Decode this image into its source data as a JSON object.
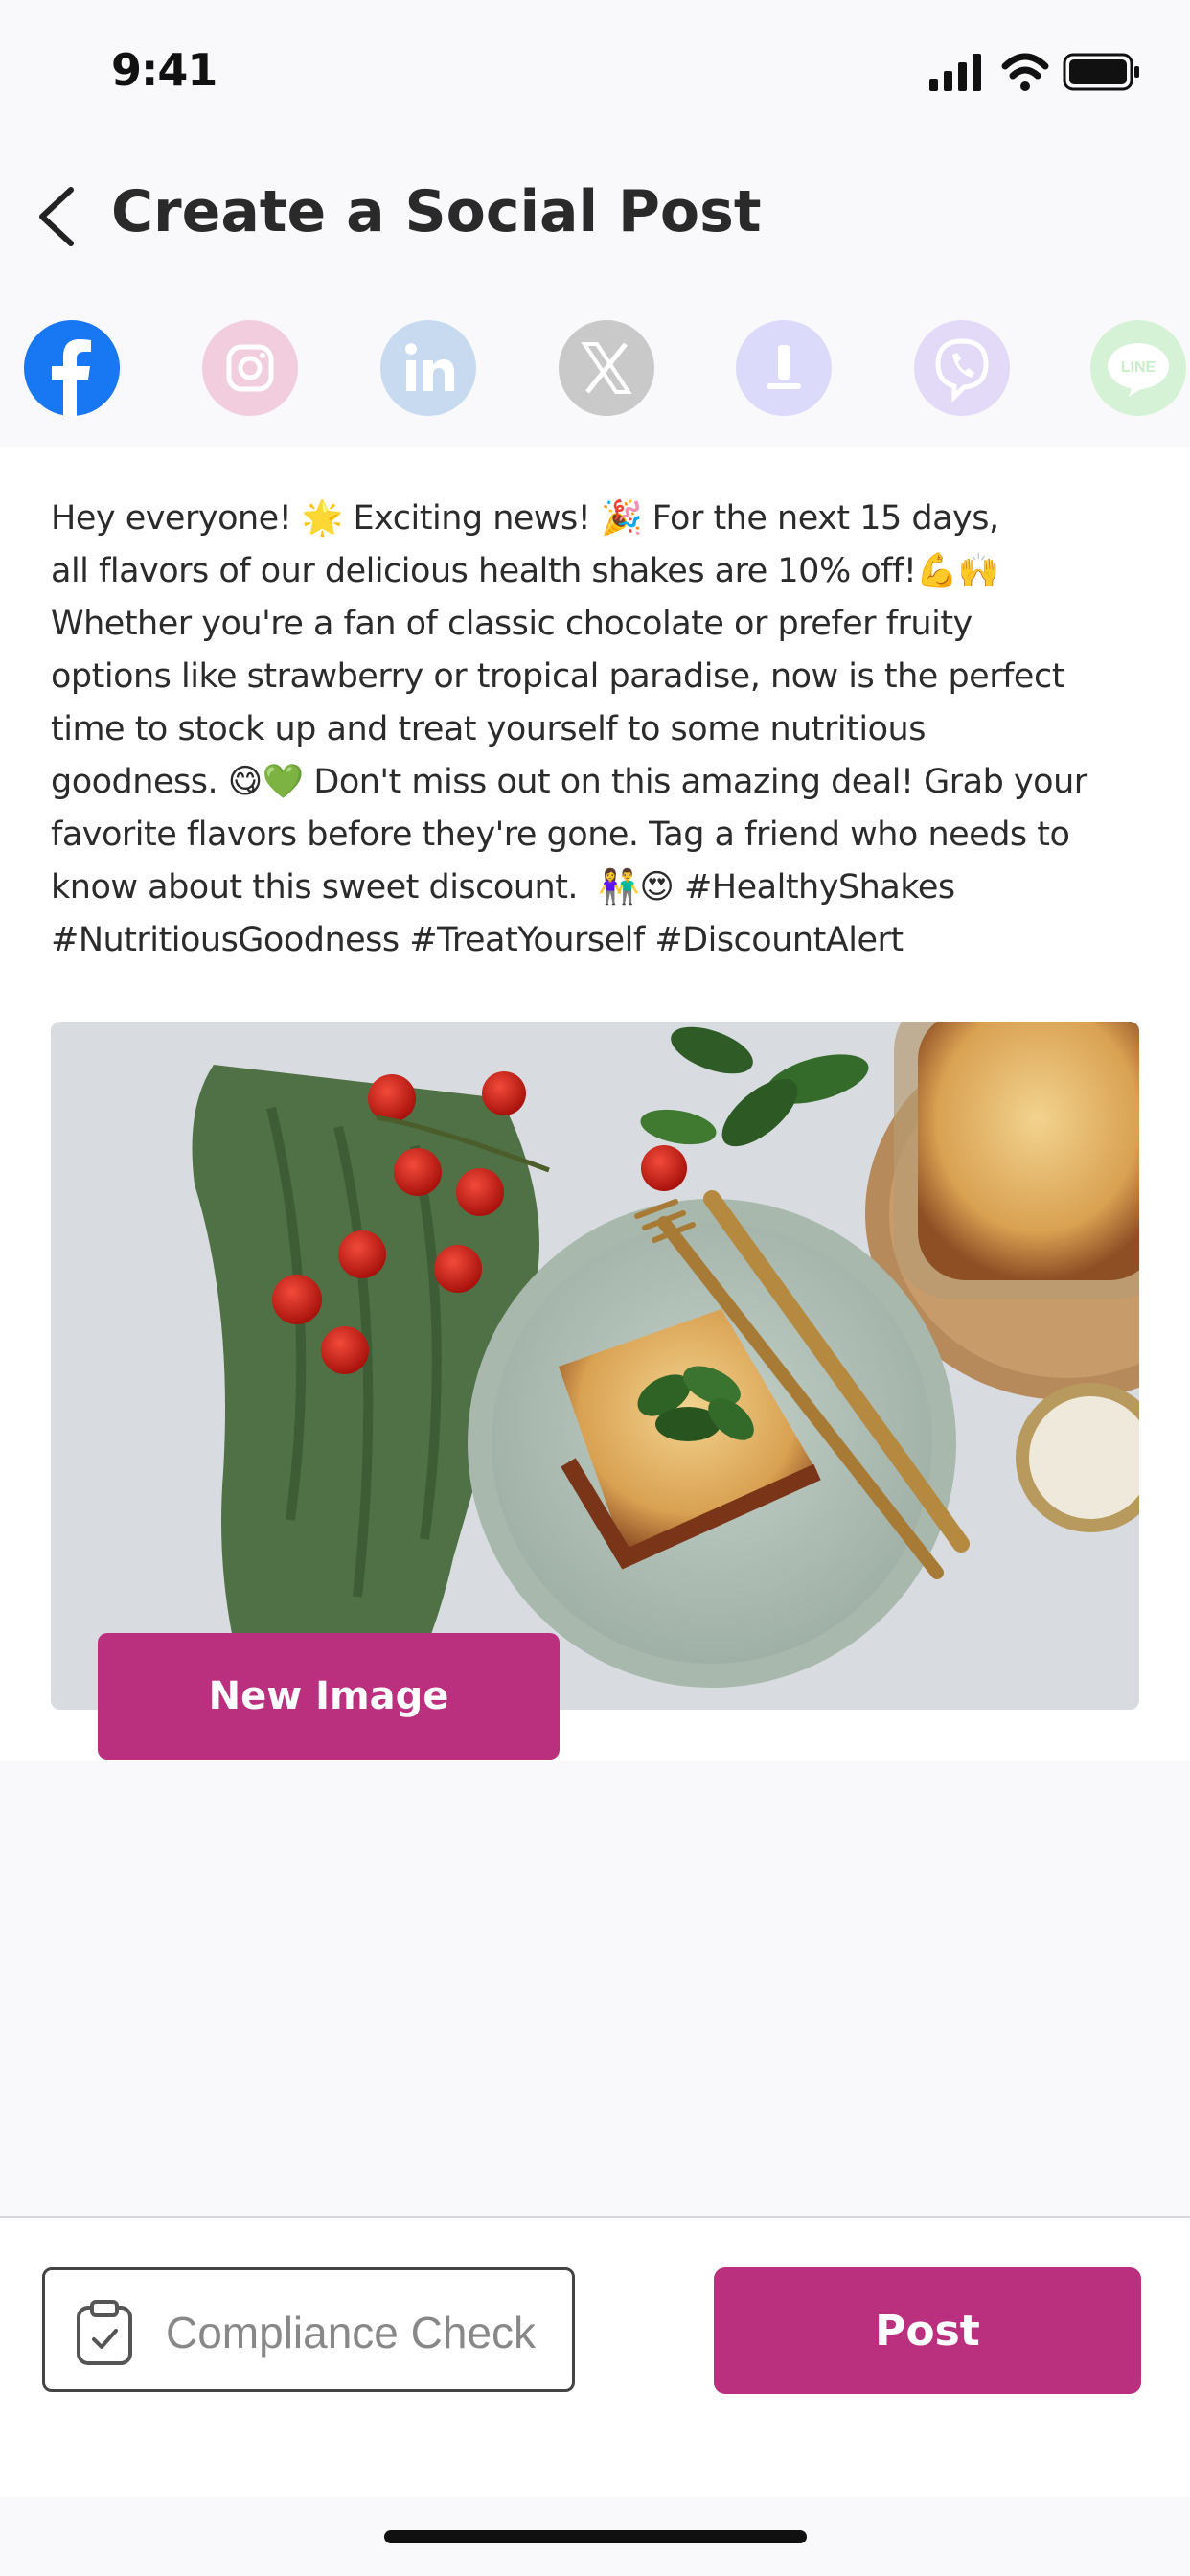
{
  "status_bar": {
    "time": "9:41",
    "icons": [
      "signal-icon",
      "wifi-icon",
      "battery-icon"
    ]
  },
  "header": {
    "back_icon": "chevron-left-icon",
    "title": "Create a Social Post"
  },
  "platforms": [
    {
      "name": "Facebook",
      "icon": "facebook-icon",
      "selected": true,
      "color": "#1877F2"
    },
    {
      "name": "Instagram",
      "icon": "instagram-icon",
      "selected": false,
      "color": "#f2cddd"
    },
    {
      "name": "LinkedIn",
      "icon": "linkedin-icon",
      "selected": false,
      "color": "#c7daf0"
    },
    {
      "name": "X",
      "icon": "x-icon",
      "selected": false,
      "color": "#c9c9c9"
    },
    {
      "name": "Phone",
      "icon": "phone-icon",
      "selected": false,
      "color": "#dcdafb"
    },
    {
      "name": "Viber",
      "icon": "viber-icon",
      "selected": false,
      "color": "#e3daf8"
    },
    {
      "name": "LINE",
      "icon": "line-icon",
      "selected": false,
      "color": "#d6f2d6"
    }
  ],
  "post": {
    "text": "Hey everyone! 🌟 Exciting news! 🎉 For the next 15 days,\nall flavors of our delicious health shakes are 10% off!💪🙌\nWhether you're a fan of classic chocolate or prefer fruity\noptions like strawberry or tropical paradise, now is the perfect\ntime to stock up and treat yourself to some nutritious\ngoodness. 😋💚 Don't miss out on this amazing deal! Grab your\nfavorite flavors before they're gone. Tag a friend who needs to\nknow about this sweet discount.  👫😍 #HealthyShakes\n#NutritiousGoodness #TreatYourself #DiscountAlert",
    "image_icon": "food-photo",
    "new_image_label": "New Image"
  },
  "actions": {
    "compliance_label": "Compliance Check",
    "compliance_icon": "clipboard-check-icon",
    "post_label": "Post"
  },
  "colors": {
    "accent": "#bb2f7f",
    "background": "#f9f9fb"
  }
}
